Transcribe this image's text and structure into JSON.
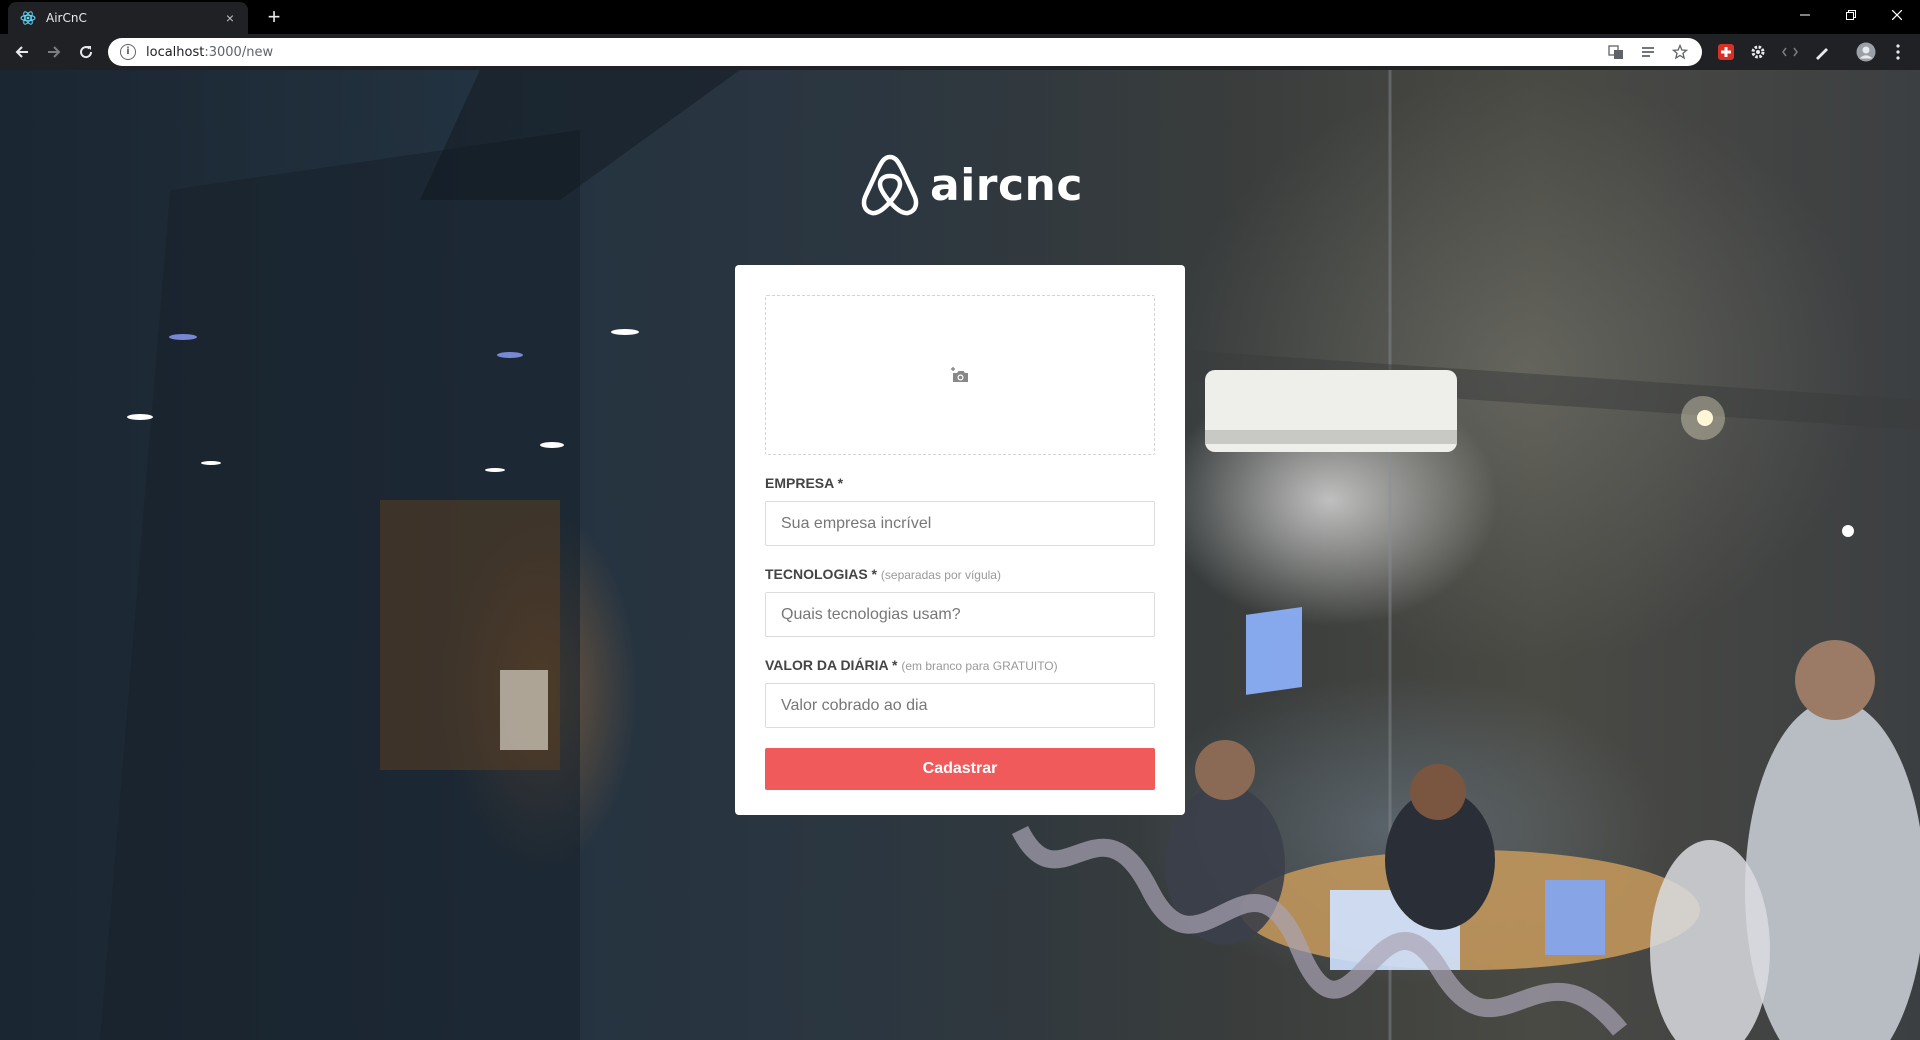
{
  "browser": {
    "tab_title": "AirCnC",
    "tab_close": "×",
    "new_tab": "+",
    "url_host": "localhost",
    "url_rest": ":3000/new",
    "info_glyph": "i",
    "window_controls": [
      "minimize",
      "restore",
      "close"
    ]
  },
  "page": {
    "logo_text": "aircnc",
    "form": {
      "upload_icon": "camera-add-icon",
      "company": {
        "label": "EMPRESA *",
        "placeholder": "Sua empresa incrível"
      },
      "techs": {
        "label": "TECNOLOGIAS *",
        "hint": "(separadas por vígula)",
        "placeholder": "Quais tecnologias usam?"
      },
      "price": {
        "label": "VALOR DA DIÁRIA *",
        "hint": "(em branco para GRATUITO)",
        "placeholder": "Valor cobrado ao dia"
      },
      "submit_label": "Cadastrar"
    }
  },
  "colors": {
    "accent": "#f05a5b",
    "card": "#ffffff",
    "chrome_dark": "#202124"
  }
}
